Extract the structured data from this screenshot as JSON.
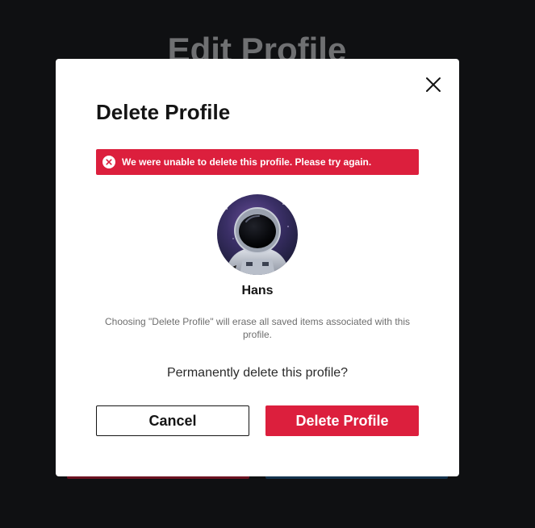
{
  "background": {
    "title": "Edit Profile"
  },
  "dialog": {
    "title": "Delete Profile",
    "error_message": "We were unable to delete this profile. Please try again.",
    "profile_name": "Hans",
    "warning": "Choosing \"Delete Profile\" will erase all saved items associated with this profile.",
    "question": "Permanently delete this profile?",
    "cancel_label": "Cancel",
    "delete_label": "Delete Profile",
    "close_icon": "close-icon",
    "error_icon": "error-circle-x-icon",
    "avatar_description": "astronaut"
  },
  "colors": {
    "accent_red": "#dc1f3d",
    "page_background": "#0f1012",
    "dialog_background": "#ffffff",
    "text_dark": "#141414",
    "text_muted": "#6e6e6e"
  }
}
